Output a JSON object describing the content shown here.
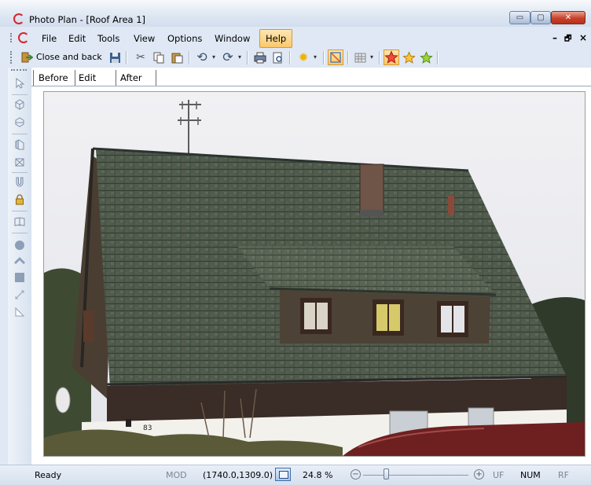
{
  "window": {
    "title": "Photo Plan - [Roof Area 1]",
    "minimize_glyph": "▭",
    "maximize_glyph": "▢",
    "close_glyph": "✕"
  },
  "menu": {
    "items": [
      "File",
      "Edit",
      "Tools",
      "View",
      "Options",
      "Window",
      "Help"
    ],
    "active": "Help",
    "mdi_min": "–",
    "mdi_restore": "🗗",
    "mdi_close": "×"
  },
  "toolbar": {
    "close_and_back": "Close and back",
    "icons": [
      "close-and-back-icon",
      "save-icon",
      "cut-icon",
      "copy-icon",
      "paste-icon",
      "undo-icon",
      "redo-icon",
      "print-icon",
      "print-preview-icon",
      "brightness-icon",
      "frame-toggle-icon",
      "grid-icon",
      "star-red-icon",
      "star-orange-icon",
      "star-green-icon"
    ]
  },
  "tools": [
    "select-arrow-icon",
    "box-3d-icon",
    "box-cut-icon",
    "wall-icon",
    "roof-box-icon",
    "magnet-icon",
    "lock-icon",
    "book-icon",
    "circle-icon",
    "roof-chevron-icon",
    "square-icon",
    "measure-line-icon",
    "triangle-icon"
  ],
  "tabs": [
    "Before",
    "Edit",
    "After"
  ],
  "active_tab": "Before",
  "status": {
    "ready": "Ready",
    "mod": "MOD",
    "coords": "(1740.0,1309.0)",
    "zoom": "24.8 %",
    "zoom_level": 0.22,
    "zoom_out": "−",
    "zoom_in": "+",
    "uf": "UF",
    "num": "NUM",
    "rf": "RF"
  },
  "photo": {
    "house_number": "83",
    "colors": {
      "sky": "#eeeef2",
      "roof": "#4e5a4c",
      "wall": "#4a3f34",
      "ground": "#f3f1ec"
    }
  },
  "colors": {
    "accent": "#fbc86a",
    "chrome": "#dfe8f4",
    "close": "#c8412b"
  }
}
